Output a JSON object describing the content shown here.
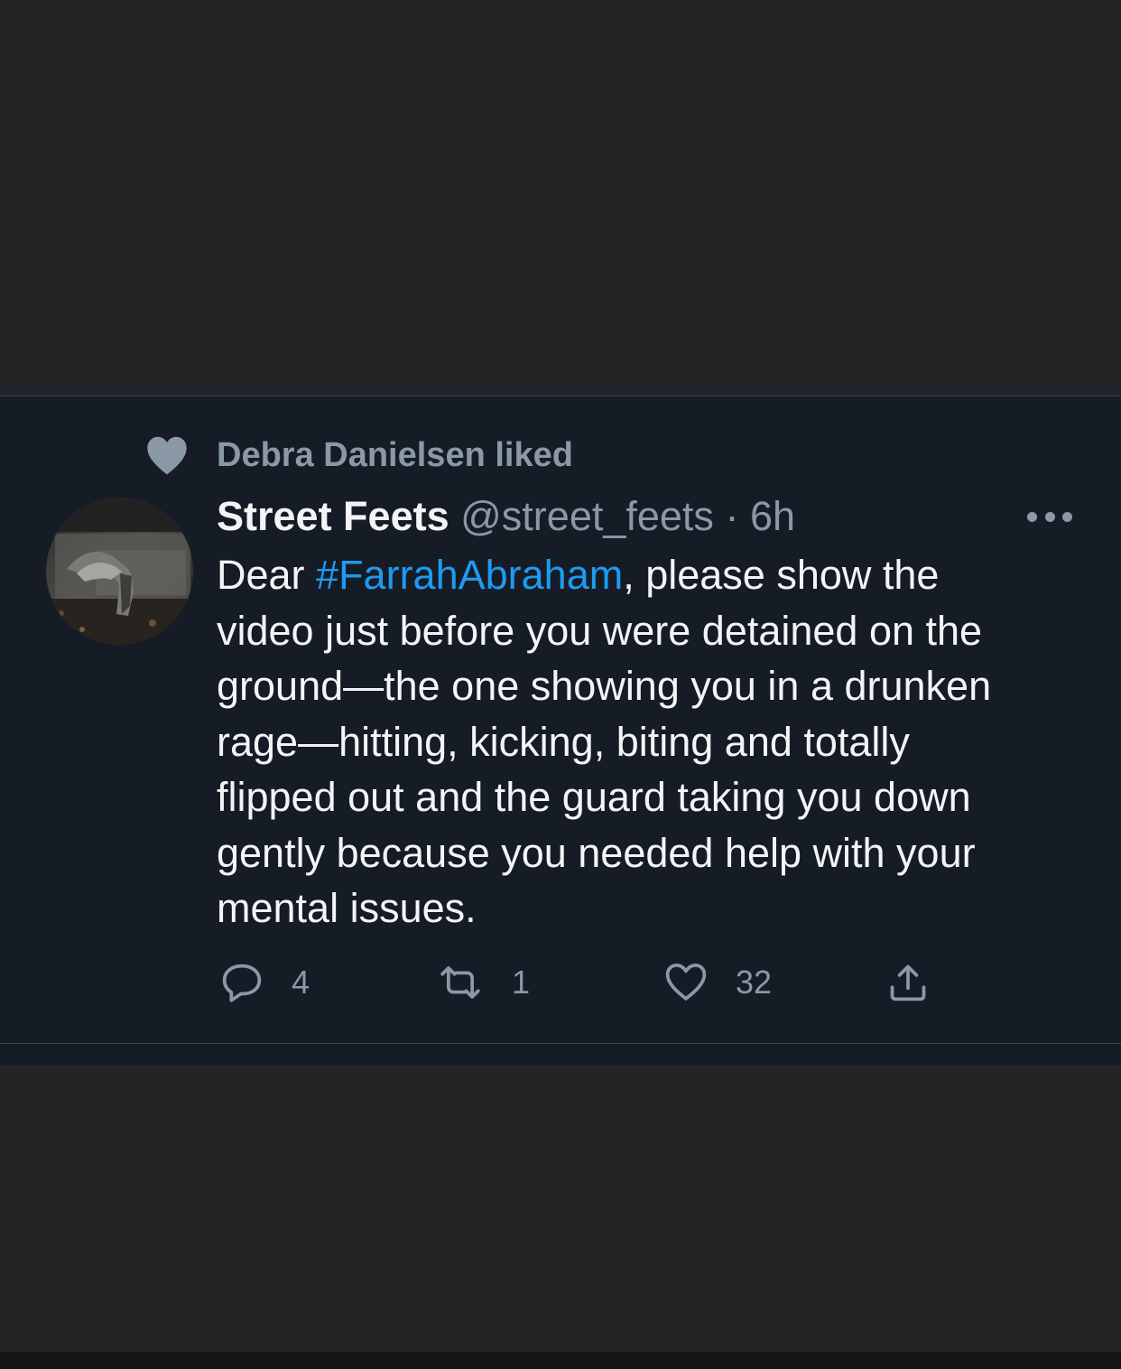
{
  "social_context": {
    "text": "Debra Danielsen liked"
  },
  "tweet": {
    "display_name": "Street Feets",
    "handle": "@street_feets",
    "separator": "·",
    "time": "6h",
    "body_lines": [
      "Dear ",
      "#FarrahAbraham",
      ", please show the",
      "video just before you were detained on the",
      "ground—the one showing you in a drunken",
      "rage—hitting, kicking, biting and totally",
      "flipped out and the guard taking you down",
      "gently because you needed help with your",
      "mental issues."
    ]
  },
  "actions": {
    "replies": "4",
    "retweets": "1",
    "likes": "32"
  },
  "icons": {
    "liked": "heart-icon",
    "more": "more-dots-icon",
    "reply": "reply-icon",
    "retweet": "retweet-icon",
    "like": "heart-outline-icon",
    "share": "share-icon"
  },
  "colors": {
    "background": "#242426",
    "card": "#161c26",
    "text": "#f2f4f6",
    "secondary_text": "#8b98a5",
    "link": "#1d9bf0"
  }
}
